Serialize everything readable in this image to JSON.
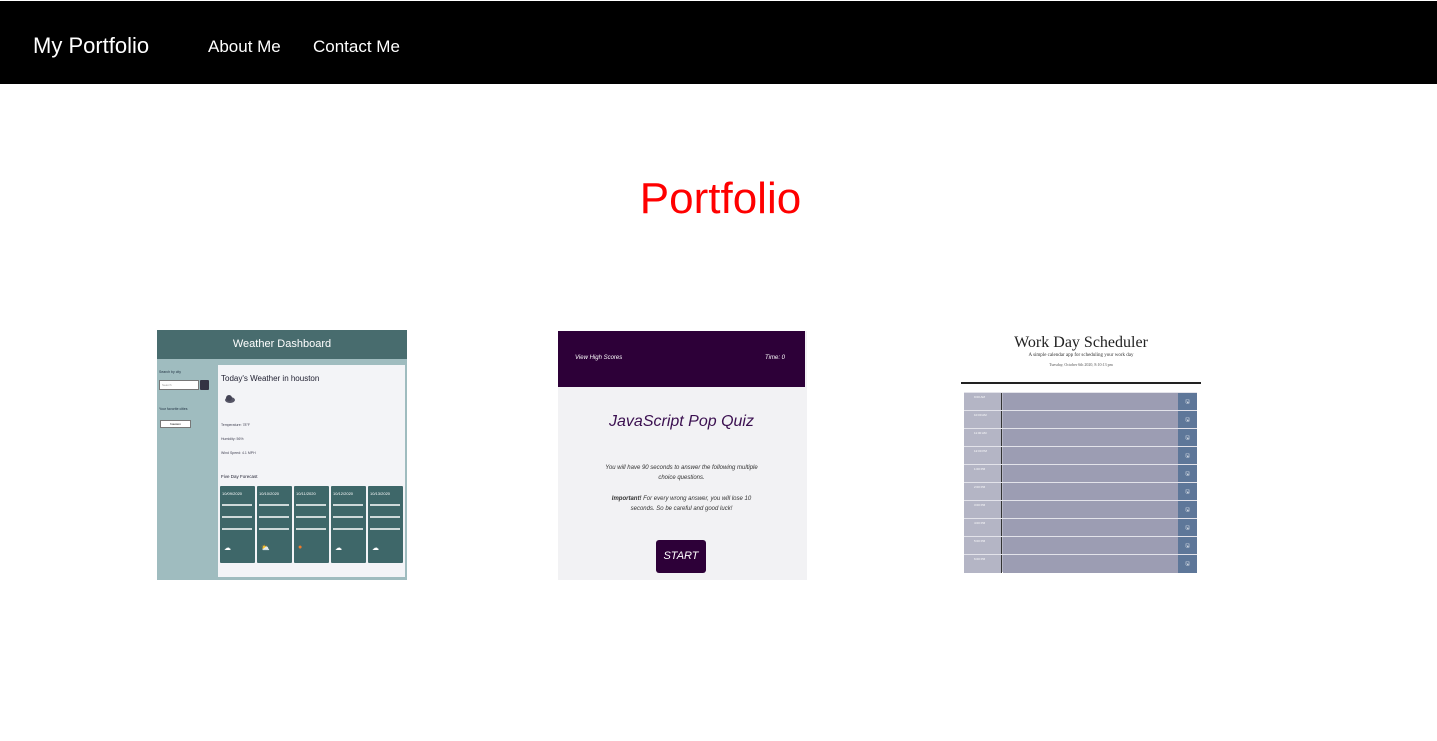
{
  "navbar": {
    "brand": "My Portfolio",
    "links": [
      "About Me",
      "Contact Me"
    ]
  },
  "page": {
    "title": "Portfolio"
  },
  "colors": {
    "navbar_bg": "#000000",
    "title": "#ff0000"
  },
  "projects": {
    "weather": {
      "header": "Weather Dashboard",
      "search_label": "Search by city",
      "search_placeholder": "Search",
      "favorites_label": "Your favorite cities",
      "history_item": "houston",
      "main_title": "Today's Weather in houston",
      "temperature": "Temperature: 78°F",
      "humidity": "Humidity: 56%",
      "wind": "Wind Speed: 4.1 MPH",
      "forecast_title": "Five Day Forecast",
      "forecast_dates": [
        "10/09/2020",
        "10/10/2020",
        "10/11/2020",
        "10/12/2020",
        "10/13/2020"
      ]
    },
    "quiz": {
      "high_scores": "View High Scores",
      "time": "Time: 0",
      "title": "JavaScript Pop Quiz",
      "instructions": "You will have 90 seconds to answer the following multiple choice questions.",
      "warning_bold": "Important!",
      "warning": "For every wrong answer, you will lose 10 seconds. So be careful and good luck!",
      "start": "START"
    },
    "scheduler": {
      "title": "Work Day Scheduler",
      "subtitle": "A simple calendar app for scheduling your work day",
      "date": "Tuesday, October 6th 2020, 8:10:13 pm",
      "hours": [
        "9:00 AM",
        "10:00 AM",
        "11:00 AM",
        "12:00 PM",
        "1:00 PM",
        "2:00 PM",
        "3:00 PM",
        "4:00 PM",
        "5:00 PM",
        "6:00 PM"
      ]
    }
  }
}
